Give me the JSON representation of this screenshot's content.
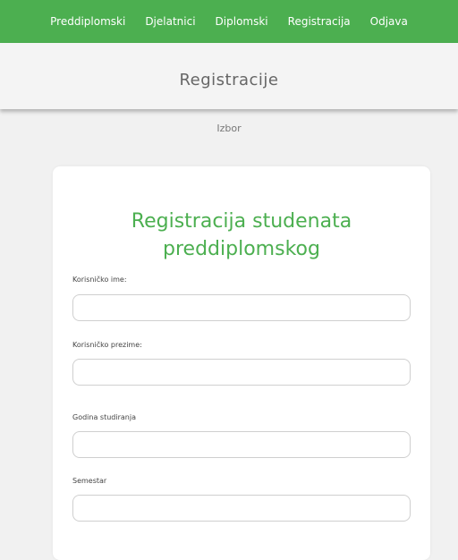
{
  "nav": {
    "items": [
      {
        "label": "Preddiplomski"
      },
      {
        "label": "Djelatnici"
      },
      {
        "label": "Diplomski"
      },
      {
        "label": "Registracija"
      },
      {
        "label": "Odjava"
      }
    ]
  },
  "header": {
    "title": "Registracije"
  },
  "subnav": {
    "link": "Izbor"
  },
  "form": {
    "title": "Registracija studenata preddiplomskog",
    "fields": [
      {
        "label": "Korisničko ime:",
        "value": ""
      },
      {
        "label": "Korisničko prezime:",
        "value": ""
      },
      {
        "label": "Godina studiranja",
        "value": ""
      },
      {
        "label": "Semestar",
        "value": ""
      }
    ]
  },
  "colors": {
    "accent": "#4caf50",
    "page_background": "#f1f1f1"
  }
}
